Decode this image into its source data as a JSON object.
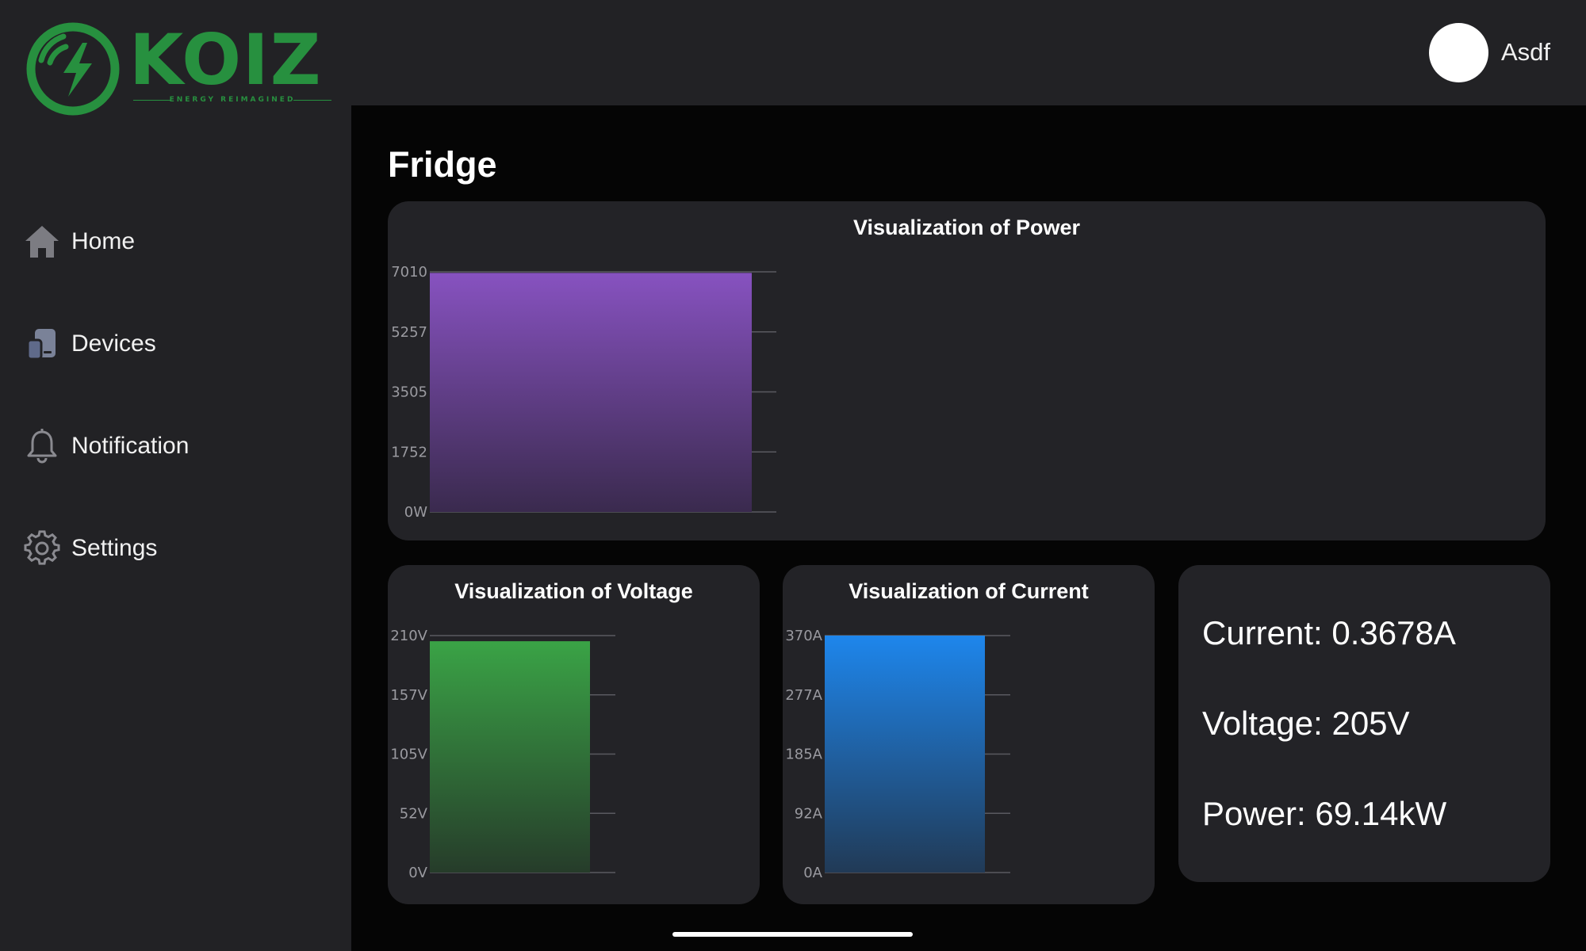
{
  "brand": {
    "name": "KOIZ",
    "tagline": "ENERGY REIMAGINED",
    "color": "#27903f"
  },
  "sidebar": {
    "items": [
      {
        "label": "Home",
        "icon": "home-icon"
      },
      {
        "label": "Devices",
        "icon": "devices-icon"
      },
      {
        "label": "Notification",
        "icon": "bell-icon"
      },
      {
        "label": "Settings",
        "icon": "gear-icon"
      }
    ]
  },
  "user": {
    "name": "Asdf"
  },
  "page": {
    "title": "Fridge"
  },
  "stats": {
    "current": "Current: 0.3678A",
    "voltage": "Voltage: 205V",
    "power": "Power: 69.14kW"
  },
  "chart_data": [
    {
      "type": "bar",
      "title": "Visualization of Power",
      "categories": [
        ""
      ],
      "values": [
        6978
      ],
      "ylim": [
        0,
        7010
      ],
      "ticks": [
        "0W",
        "1752",
        "3505",
        "5257",
        "7010"
      ],
      "grid": true,
      "colors": [
        "#8752c0",
        "#3a2a4e"
      ]
    },
    {
      "type": "bar",
      "title": "Visualization of Voltage",
      "categories": [
        ""
      ],
      "values": [
        205
      ],
      "ylim": [
        0,
        210
      ],
      "ticks": [
        "0V",
        "52V",
        "105V",
        "157V",
        "210V"
      ],
      "grid": true,
      "colors": [
        "#3aa346",
        "#263c2a"
      ]
    },
    {
      "type": "bar",
      "title": "Visualization of Current",
      "categories": [
        ""
      ],
      "values": [
        370
      ],
      "ylim": [
        0,
        370
      ],
      "ticks": [
        "0A",
        "92A",
        "185A",
        "277A",
        "370A"
      ],
      "grid": true,
      "colors": [
        "#1e86ec",
        "#213a56"
      ]
    }
  ]
}
